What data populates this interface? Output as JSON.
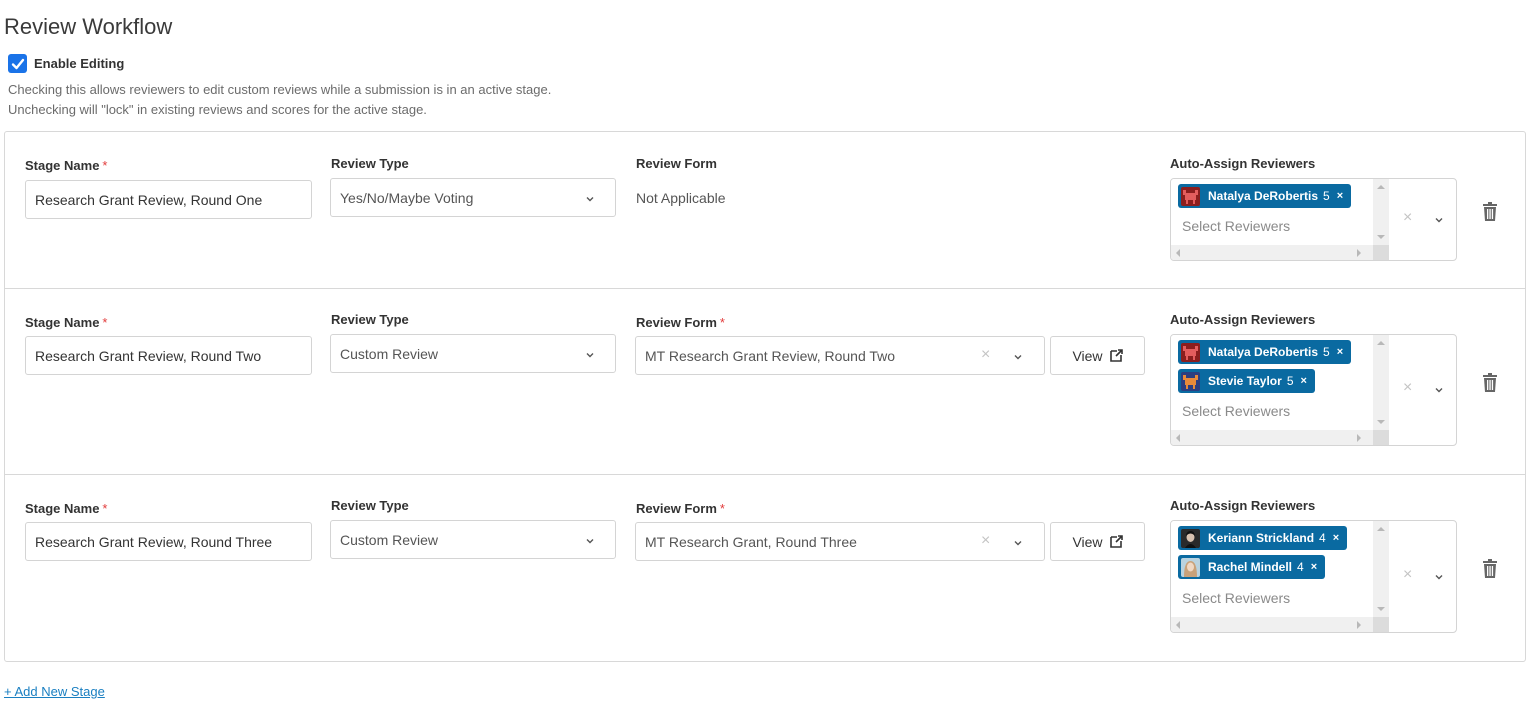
{
  "page": {
    "title": "Review Workflow",
    "enable_editing": {
      "label": "Enable Editing",
      "checked": true
    },
    "help_lines": [
      "Checking this allows reviewers to edit custom reviews while a submission is in an active stage.",
      "Unchecking will \"lock\" in existing reviews and scores for the active stage."
    ],
    "add_stage_label": "+ Add New Stage"
  },
  "labels": {
    "stage_name": "Stage Name",
    "required_mark": "*",
    "review_type": "Review Type",
    "review_form": "Review Form",
    "auto_assign": "Auto-Assign Reviewers",
    "select_reviewers_placeholder": "Select Reviewers",
    "view_button": "View",
    "clear_icon": "×",
    "chip_remove": "×"
  },
  "stages": [
    {
      "stage_name": "Research Grant Review, Round One",
      "review_type": "Yes/No/Maybe Voting",
      "review_form_required": false,
      "review_form": "Not Applicable",
      "reviewers": [
        {
          "name": "Natalya DeRobertis",
          "count": "5",
          "avatar": "robot-avatar-red"
        }
      ]
    },
    {
      "stage_name": "Research Grant Review, Round Two",
      "review_type": "Custom Review",
      "review_form_required": true,
      "review_form": "MT Research Grant Review, Round Two",
      "reviewers": [
        {
          "name": "Natalya DeRobertis",
          "count": "5",
          "avatar": "robot-avatar-red"
        },
        {
          "name": "Stevie Taylor",
          "count": "5",
          "avatar": "robot-avatar-blue"
        }
      ]
    },
    {
      "stage_name": "Research Grant Review, Round Three",
      "review_type": "Custom Review",
      "review_form_required": true,
      "review_form": "MT Research Grant, Round Three",
      "reviewers": [
        {
          "name": "Keriann Strickland",
          "count": "4",
          "avatar": "photo-avatar-dark"
        },
        {
          "name": "Rachel Mindell",
          "count": "4",
          "avatar": "photo-avatar-light"
        }
      ]
    }
  ],
  "colors": {
    "chip_bg": "#0a6aa1",
    "checkbox": "#1a73e8",
    "required": "#e23b3b",
    "link": "#1a7fc1"
  }
}
